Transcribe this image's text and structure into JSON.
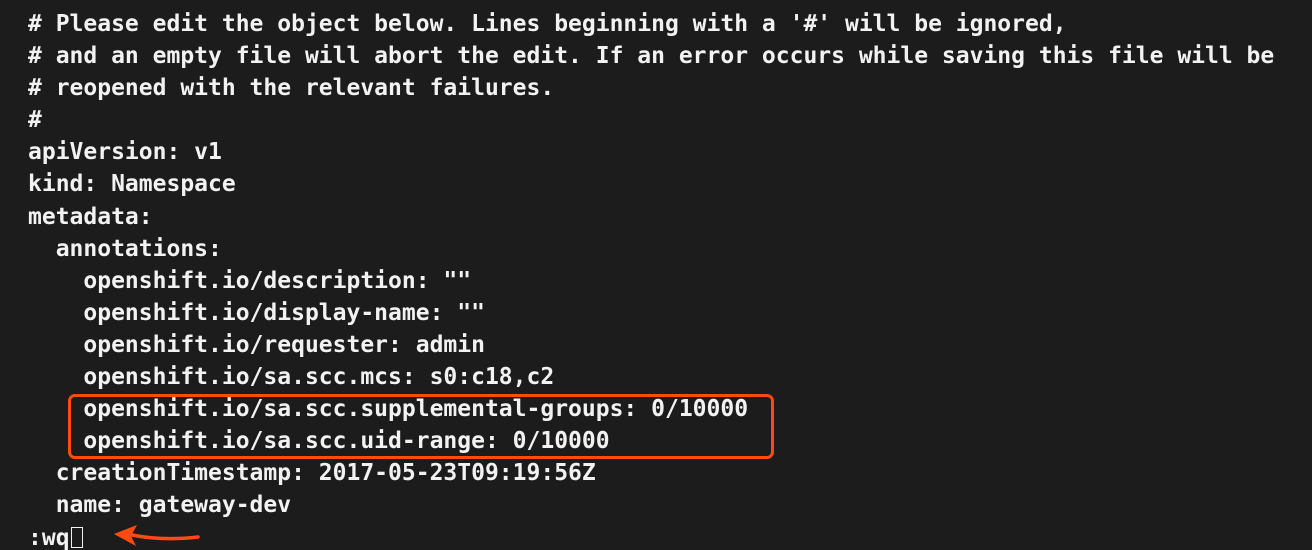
{
  "editor": {
    "lines": [
      "# Please edit the object below. Lines beginning with a '#' will be ignored,",
      "# and an empty file will abort the edit. If an error occurs while saving this file will be",
      "# reopened with the relevant failures.",
      "#",
      "apiVersion: v1",
      "kind: Namespace",
      "metadata:",
      "  annotations:",
      "    openshift.io/description: \"\"",
      "    openshift.io/display-name: \"\"",
      "    openshift.io/requester: admin",
      "    openshift.io/sa.scc.mcs: s0:c18,c2",
      "    openshift.io/sa.scc.supplemental-groups: 0/10000",
      "    openshift.io/sa.scc.uid-range: 0/10000",
      "  creationTimestamp: 2017-05-23T09:19:56Z",
      "  name: gateway-dev"
    ],
    "command": ":wq"
  },
  "annotations": {
    "highlight_color": "#ff4a12",
    "arrow_color": "#ff4a12",
    "arrow_icon": "arrow-left-icon"
  },
  "colors": {
    "background": "#1c1c1c",
    "text": "#f2f2f2"
  }
}
